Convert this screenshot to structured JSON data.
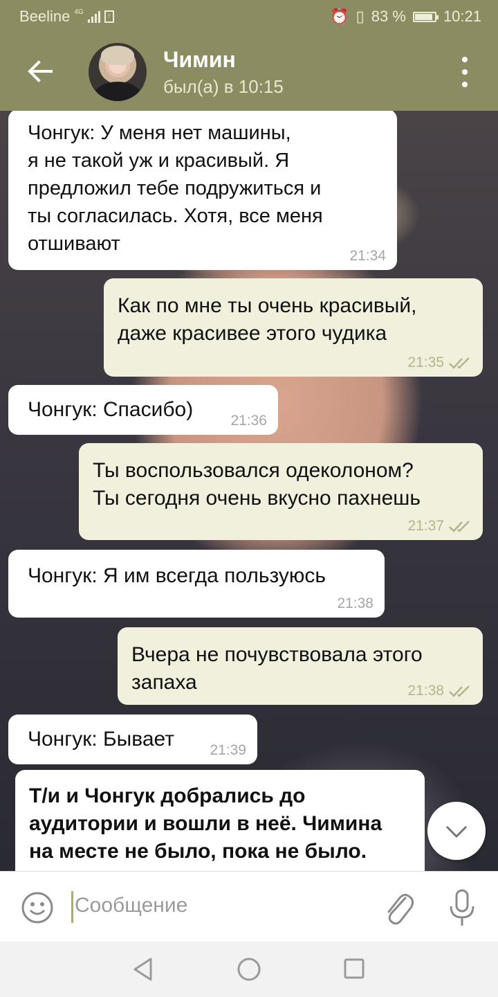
{
  "status_bar": {
    "carrier": "Beeline",
    "network": "4G",
    "battery": "83 %",
    "battery_level": 0.83,
    "time": "10:21"
  },
  "header": {
    "contact_name": "Чимин",
    "last_seen": "был(а) в 10:15"
  },
  "messages": [
    {
      "dir": "in",
      "text": "Чонгук: У меня нет машины,\nя не такой уж и красивый. Я\nпредложил тебе подружиться и\nты согласилась. Хотя, все меня\nотшивают",
      "time": "21:34"
    },
    {
      "dir": "out",
      "text": "Как по мне ты очень красивый,\nдаже красивее этого чудика",
      "time": "21:35"
    },
    {
      "dir": "in",
      "text": "Чонгук: Спасибо)",
      "time": "21:36"
    },
    {
      "dir": "out",
      "text": "Ты воспользовался одеколоном?\nТы сегодня очень вкусно пахнешь",
      "time": "21:37"
    },
    {
      "dir": "in",
      "text": "Чонгук: Я им всегда пользуюсь",
      "time": "21:38"
    },
    {
      "dir": "out",
      "text": "Вчера не почувствовала этого\nзапаха",
      "time": "21:38"
    },
    {
      "dir": "in",
      "text": "Чонгук: Бывает",
      "time": "21:39"
    },
    {
      "dir": "in",
      "text": "Т/и и Чонгук добрались до\nаудитории и вошли в неё. Чимина\nна месте не было, пока не было.",
      "time": ""
    }
  ],
  "input": {
    "placeholder": "Сообщение"
  },
  "colors": {
    "header": "#8c8c63",
    "outgoing_bubble": "#f0f0dc",
    "incoming_bubble": "#ffffff",
    "read_checks": "#b3b38e"
  },
  "icons": {
    "back": "arrow-left-icon",
    "menu": "more-vert-icon",
    "emoji": "smiley-icon",
    "attach": "paperclip-icon",
    "mic": "microphone-icon",
    "scroll": "chevron-down-icon"
  }
}
